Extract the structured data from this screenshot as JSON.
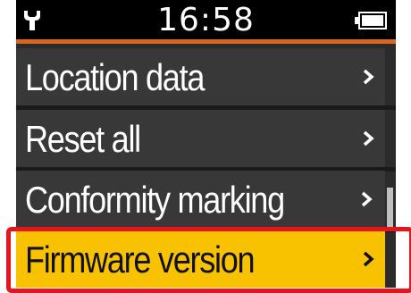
{
  "status_bar": {
    "time": "16:58",
    "setup_icon": "wrench-icon",
    "battery_icon": "battery-full-icon"
  },
  "menu": {
    "items": [
      {
        "label": "Location data",
        "icon": "chevron-right-icon"
      },
      {
        "label": "Reset all",
        "icon": "chevron-right-icon"
      },
      {
        "label": "Conformity marking",
        "icon": "chevron-right-icon"
      },
      {
        "label": "Firmware version",
        "icon": "chevron-right-icon",
        "selected": true
      }
    ]
  },
  "colors": {
    "accent_line": "#d9661f",
    "selection": "#f8c200",
    "highlight_frame": "#e8141b",
    "row_background": "#383838"
  }
}
